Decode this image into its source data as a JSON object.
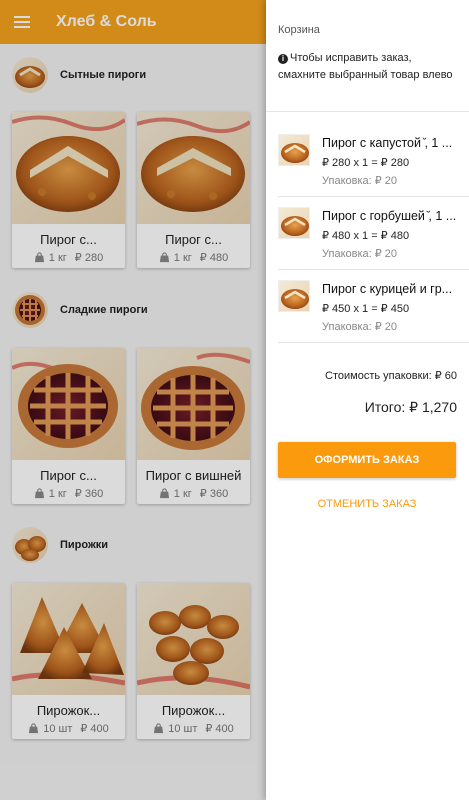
{
  "app": {
    "title": "Хлеб & Соль",
    "accent": "#f5a21c"
  },
  "sections": [
    {
      "title": "Сытные пироги",
      "cards": [
        {
          "name": "Пирог с...",
          "weight": "1 кг",
          "price": "₽ 280"
        },
        {
          "name": "Пирог с...",
          "weight": "1 кг",
          "price": "₽ 480"
        }
      ]
    },
    {
      "title": "Сладкие пироги",
      "cards": [
        {
          "name": "Пирог с...",
          "weight": "1 кг",
          "price": "₽ 360"
        },
        {
          "name": "Пирог с вишней",
          "weight": "1 кг",
          "price": "₽ 360"
        }
      ]
    },
    {
      "title": "Пирожки",
      "cards": [
        {
          "name": "Пирожок...",
          "weight": "10 шт",
          "price": "₽ 400"
        },
        {
          "name": "Пирожок...",
          "weight": "10 шт",
          "price": "₽ 400"
        }
      ]
    }
  ],
  "cart": {
    "title": "Корзина",
    "hint": "Чтобы исправить заказ, смахните выбранный товар влево",
    "items": [
      {
        "name": "Пирог с капустой ̆, 1 ...",
        "price_line": "₽ 280 x 1 = ₽ 280",
        "packaging": "Упаковка: ₽ 20"
      },
      {
        "name": "Пирог с горбушей ̆, 1 ...",
        "price_line": "₽ 480 x 1 = ₽ 480",
        "packaging": "Упаковка: ₽ 20"
      },
      {
        "name": "Пирог с курицей и гр...",
        "price_line": "₽ 450 x 1 = ₽ 450",
        "packaging": "Упаковка: ₽ 20"
      }
    ],
    "packaging_cost": "Стоимость упаковки: ₽ 60",
    "total": "Итого: ₽ 1,270",
    "order_button": "ОФОРМИТЬ ЗАКАЗ",
    "cancel_button": "ОТМЕНИТЬ ЗАКАЗ",
    "button_color": "#fb9a0d"
  }
}
